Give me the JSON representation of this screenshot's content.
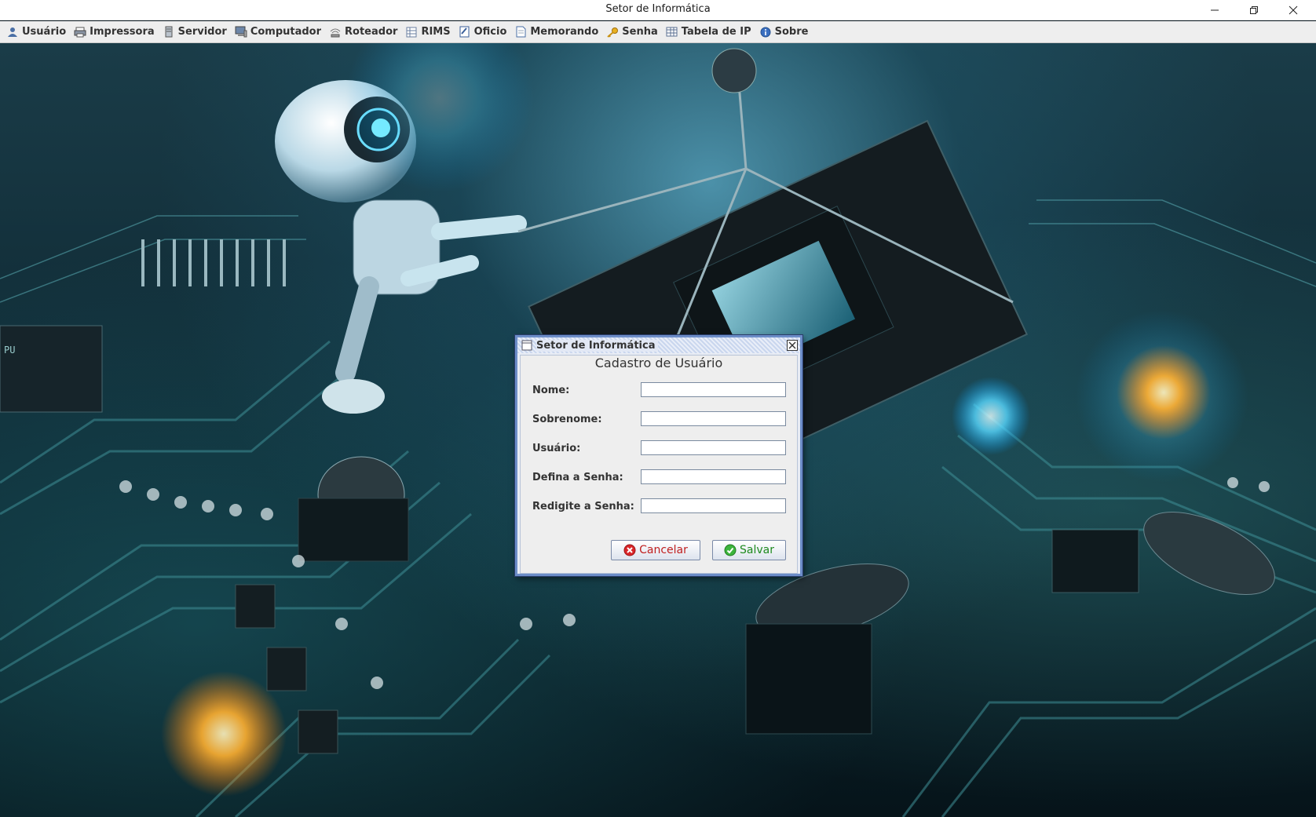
{
  "window": {
    "title": "Setor de Informática",
    "controls": {
      "minimize": "—",
      "maximize": "❐",
      "close": "✕"
    }
  },
  "menubar": {
    "items": [
      {
        "label": "Usuário",
        "icon": "user-icon"
      },
      {
        "label": "Impressora",
        "icon": "printer-icon"
      },
      {
        "label": "Servidor",
        "icon": "server-icon"
      },
      {
        "label": "Computador",
        "icon": "computer-icon"
      },
      {
        "label": "Roteador",
        "icon": "router-icon"
      },
      {
        "label": "RIMS",
        "icon": "table-icon"
      },
      {
        "label": "Oficio",
        "icon": "document-edit-icon"
      },
      {
        "label": "Memorando",
        "icon": "document-icon"
      },
      {
        "label": "Senha",
        "icon": "key-icon"
      },
      {
        "label": "Tabela de IP",
        "icon": "table-grid-icon"
      },
      {
        "label": "Sobre",
        "icon": "info-icon"
      }
    ]
  },
  "dialog": {
    "title": "Setor de Informática",
    "heading": "Cadastro de Usuário",
    "fields": [
      {
        "label": "Nome:",
        "value": "",
        "placeholder": ""
      },
      {
        "label": "Sobrenome:",
        "value": "",
        "placeholder": ""
      },
      {
        "label": "Usuário:",
        "value": "",
        "placeholder": ""
      },
      {
        "label": "Defina a Senha:",
        "value": "",
        "placeholder": ""
      },
      {
        "label": "Redigite a Senha:",
        "value": "",
        "placeholder": ""
      }
    ],
    "buttons": {
      "cancel_label": "Cancelar",
      "save_label": "Salvar"
    }
  },
  "colors": {
    "cancel_text": "#c02020",
    "save_text": "#1e8a1e",
    "frame_border": "#6c8dc8"
  }
}
